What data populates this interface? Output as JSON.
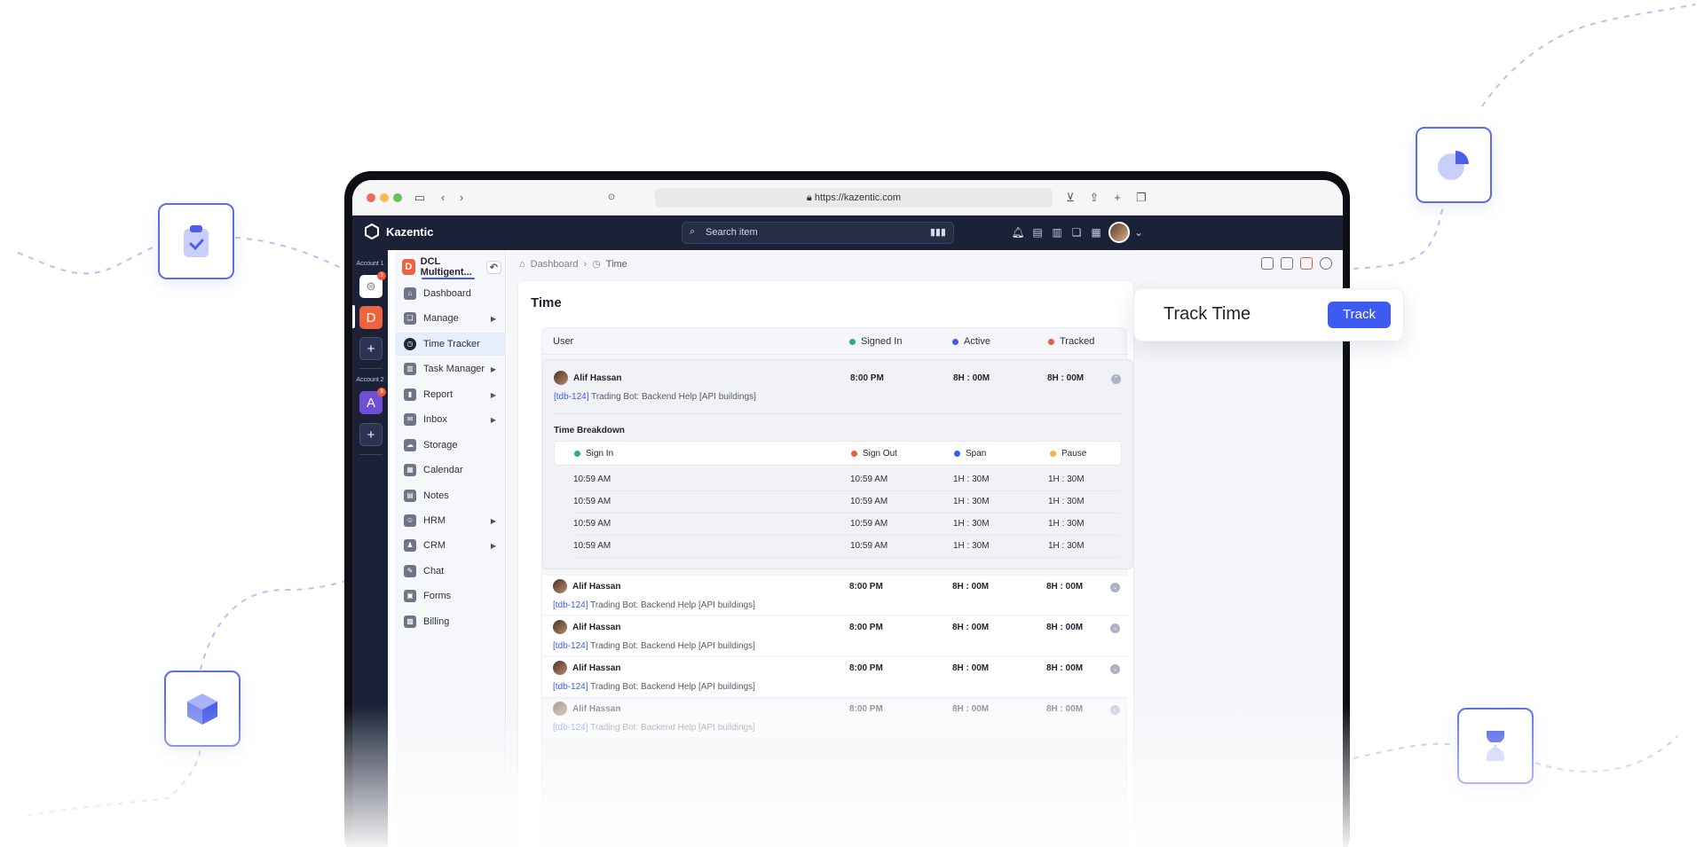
{
  "browser": {
    "url": "https://kazentic.com"
  },
  "app": {
    "name": "Kazentic",
    "search_placeholder": "Search item"
  },
  "accounts": {
    "account1_label": "Account 1",
    "account2_label": "Account 2",
    "tile_d": "D",
    "tile_a": "A",
    "badge_count": "3",
    "add_label": "+"
  },
  "workspace": {
    "initial": "D",
    "name": "DCL Multigent..."
  },
  "nav": [
    {
      "label": "Dashboard"
    },
    {
      "label": "Manage"
    },
    {
      "label": "Time Tracker"
    },
    {
      "label": "Task Manager"
    },
    {
      "label": "Report"
    },
    {
      "label": "Inbox"
    },
    {
      "label": "Storage"
    },
    {
      "label": "Calendar"
    },
    {
      "label": "Notes"
    },
    {
      "label": "HRM"
    },
    {
      "label": "CRM"
    },
    {
      "label": "Chat"
    },
    {
      "label": "Forms"
    },
    {
      "label": "Billing"
    }
  ],
  "breadcrumb": {
    "root": "Dashboard",
    "current": "Time"
  },
  "page": {
    "title": "Time"
  },
  "table": {
    "headers": {
      "user": "User",
      "signed_in": "Signed In",
      "active": "Active",
      "tracked": "Tracked"
    },
    "rows": [
      {
        "user": "Alif Hassan",
        "signed_in": "8:00 PM",
        "active": "8H : 00M",
        "tracked": "8H : 00M",
        "task_id": "[tdb-124]",
        "task": "Trading Bot: Backend Help [API buildings]"
      },
      {
        "user": "Alif Hassan",
        "signed_in": "8:00 PM",
        "active": "8H : 00M",
        "tracked": "8H : 00M",
        "task_id": "[tdb-124]",
        "task": "Trading Bot: Backend Help [API buildings]"
      },
      {
        "user": "Alif Hassan",
        "signed_in": "8:00 PM",
        "active": "8H : 00M",
        "tracked": "8H : 00M",
        "task_id": "[tdb-124]",
        "task": "Trading Bot: Backend Help [API buildings]"
      },
      {
        "user": "Alif Hassan",
        "signed_in": "8:00 PM",
        "active": "8H : 00M",
        "tracked": "8H : 00M",
        "task_id": "[tdb-124]",
        "task": "Trading Bot: Backend Help [API buildings]"
      },
      {
        "user": "Alif Hassan",
        "signed_in": "8:00 PM",
        "active": "8H : 00M",
        "tracked": "8H : 00M",
        "task_id": "[tdb-124]",
        "task": "Trading Bot: Backend Help [API buildings]"
      }
    ]
  },
  "breakdown": {
    "title": "Time Breakdown",
    "headers": {
      "sign_in": "Sign In",
      "sign_out": "Sign Out",
      "span": "Span",
      "pause": "Pause"
    },
    "rows": [
      {
        "sign_in": "10:59 AM",
        "sign_out": "10:59 AM",
        "span": "1H : 30M",
        "pause": "1H : 30M"
      },
      {
        "sign_in": "10:59 AM",
        "sign_out": "10:59 AM",
        "span": "1H : 30M",
        "pause": "1H : 30M"
      },
      {
        "sign_in": "10:59 AM",
        "sign_out": "10:59 AM",
        "span": "1H : 30M",
        "pause": "1H : 30M"
      },
      {
        "sign_in": "10:59 AM",
        "sign_out": "10:59 AM",
        "span": "1H : 30M",
        "pause": "1H : 30M"
      }
    ]
  },
  "track_popup": {
    "title": "Track Time",
    "button": "Track"
  },
  "colors": {
    "accent": "#3d5af1",
    "signed_in_dot": "#22b573",
    "active_dot": "#3d5af1",
    "tracked_dot": "#ef5a3c",
    "pause_dot": "#f2b441",
    "header_bg": "#1b2238"
  },
  "icons": {
    "floating": [
      "clipboard-check-icon",
      "pie-chart-icon",
      "cube-icon",
      "hourglass-icon"
    ]
  }
}
